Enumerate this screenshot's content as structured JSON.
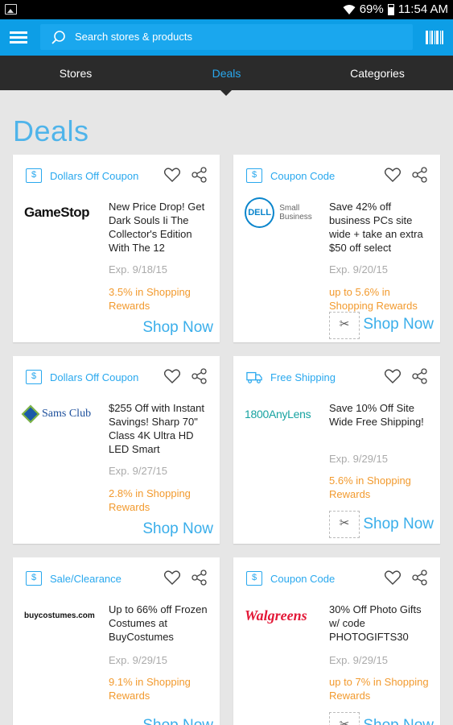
{
  "status_bar": {
    "battery": "69%",
    "time": "11:54 AM"
  },
  "search": {
    "placeholder": "Search stores & products"
  },
  "tabs": [
    {
      "label": "Stores",
      "active": false
    },
    {
      "label": "Deals",
      "active": true
    },
    {
      "label": "Categories",
      "active": false
    }
  ],
  "page_title": "Deals",
  "colors": {
    "primary": "#0d9ee6",
    "tab_bar": "#2b2b2b",
    "reward": "#f29a2e",
    "link": "#3aaeea"
  },
  "deals": [
    {
      "type": "Dollars Off Coupon",
      "type_icon": "dollar-icon",
      "store": "GameStop",
      "description": "New Price Drop! Get Dark Souls Ii The Collector's Edition With The 12",
      "expiry": "Exp. 9/18/15",
      "reward": "3.5% in Shopping Rewards",
      "cta": "Shop Now",
      "has_clip": false
    },
    {
      "type": "Coupon Code",
      "type_icon": "dollar-icon",
      "store": "DELL",
      "store_sub": "Small Business",
      "description": "Save 42% off business PCs site wide + take an extra $50 off select",
      "expiry": "Exp. 9/20/15",
      "reward": "up to 5.6% in Shopping Rewards",
      "cta": "Shop Now",
      "has_clip": true
    },
    {
      "type": "Dollars Off Coupon",
      "type_icon": "dollar-icon",
      "store": "Sams Club",
      "description": "$255 Off with Instant Savings! Sharp 70\" Class 4K Ultra HD LED Smart",
      "expiry": "Exp. 9/27/15",
      "reward": "2.8% in Shopping Rewards",
      "cta": "Shop Now",
      "has_clip": false
    },
    {
      "type": "Free Shipping",
      "type_icon": "truck-icon",
      "store": "1800AnyLens",
      "description": "Save 10% Off Site Wide Free Shipping!",
      "expiry": "Exp. 9/29/15",
      "reward": "5.6% in Shopping Rewards",
      "cta": "Shop Now",
      "has_clip": true
    },
    {
      "type": "Sale/Clearance",
      "type_icon": "dollar-icon",
      "store": "buycostumes.com",
      "description": "Up to 66% off Frozen Costumes at BuyCostumes",
      "expiry": "Exp. 9/29/15",
      "reward": "9.1% in Shopping Rewards",
      "cta": "Shop Now",
      "has_clip": false
    },
    {
      "type": "Coupon Code",
      "type_icon": "dollar-icon",
      "store": "Walgreens",
      "description": "30% Off Photo Gifts w/ code PHOTOGIFTS30",
      "expiry": "Exp. 9/29/15",
      "reward": "up to 7% in Shopping Rewards",
      "cta": "Shop Now",
      "has_clip": true
    }
  ]
}
